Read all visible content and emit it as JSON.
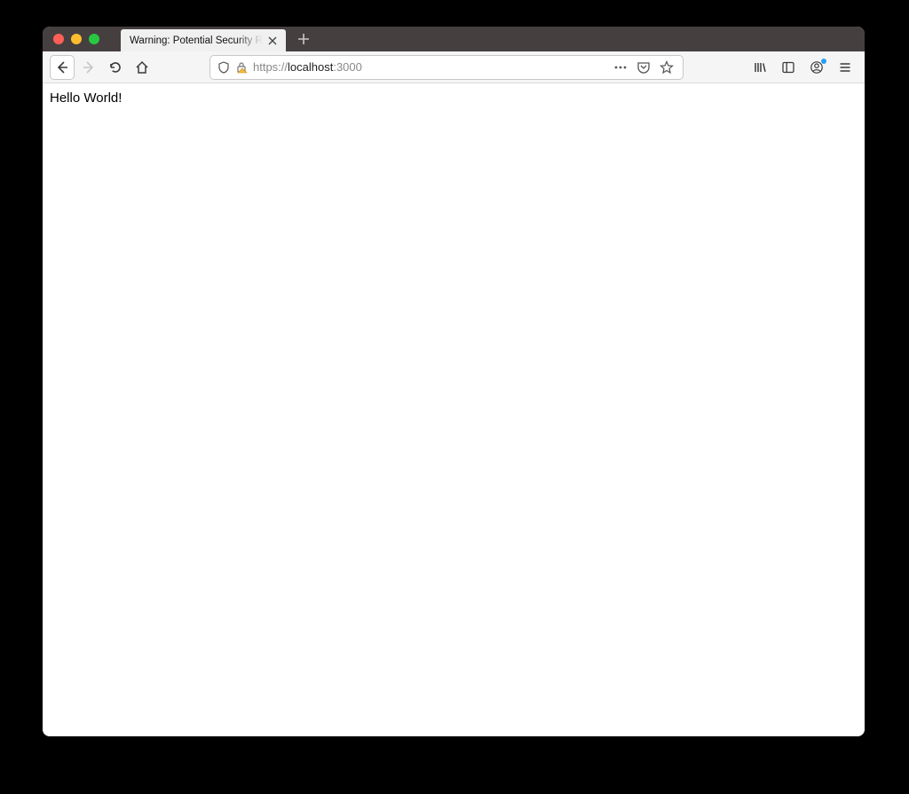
{
  "tab": {
    "title": "Warning: Potential Security Risk Ahead"
  },
  "url": {
    "scheme": "https://",
    "host": "localhost",
    "port": ":3000"
  },
  "page": {
    "body": "Hello World!"
  }
}
